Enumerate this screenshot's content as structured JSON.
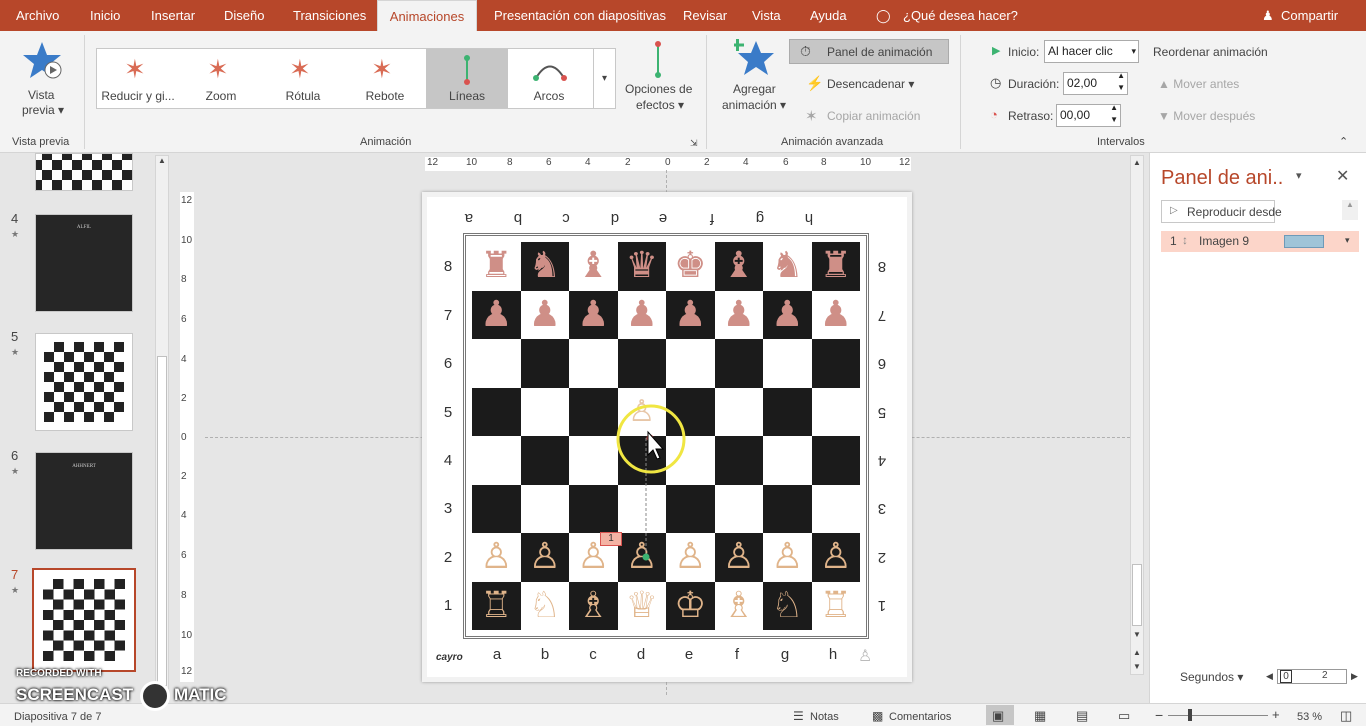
{
  "colors": {
    "accent": "#b7472a",
    "highlight": "#d5d5d5",
    "motion_path": "#3cb371",
    "cursor_highlight": "#f0e642",
    "slide_selected_border": "#b7472a"
  },
  "tabs": [
    {
      "label": "Archivo"
    },
    {
      "label": "Inicio"
    },
    {
      "label": "Insertar"
    },
    {
      "label": "Diseño"
    },
    {
      "label": "Transiciones"
    },
    {
      "label": "Animaciones",
      "active": true
    },
    {
      "label": "Presentación con diapositivas"
    },
    {
      "label": "Revisar"
    },
    {
      "label": "Vista"
    },
    {
      "label": "Ayuda"
    }
  ],
  "tellme": "¿Qué desea hacer?",
  "share": "Compartir",
  "ribbon": {
    "preview_label": "Vista\nprevia",
    "preview_line1": "Vista",
    "preview_line2": "previa",
    "group_preview": "Vista previa",
    "gallery": [
      {
        "label": "Reducir y gi...",
        "icon": "shrink-turn-star-icon"
      },
      {
        "label": "Zoom",
        "icon": "zoom-star-icon"
      },
      {
        "label": "Rótula",
        "icon": "swivel-star-icon"
      },
      {
        "label": "Rebote",
        "icon": "bounce-star-icon"
      },
      {
        "label": "Líneas",
        "icon": "lines-path-icon",
        "selected": true
      },
      {
        "label": "Arcos",
        "icon": "arcs-path-icon"
      }
    ],
    "effect_options_line1": "Opciones de",
    "effect_options_line2": "efectos",
    "group_animation": "Animación",
    "add_animation_line1": "Agregar",
    "add_animation_line2": "animación",
    "animation_pane": "Panel de animación",
    "trigger": "Desencadenar",
    "copy_animation": "Copiar animación",
    "group_advanced": "Animación avanzada",
    "start_label": "Inicio:",
    "start_value": "Al hacer clic",
    "duration_label": "Duración:",
    "duration_value": "02,00",
    "delay_label": "Retraso:",
    "delay_value": "00,00",
    "reorder_title": "Reordenar animación",
    "move_earlier": "Mover antes",
    "move_later": "Mover después",
    "group_timing": "Intervalos"
  },
  "slides": [
    {
      "num": "4",
      "type": "dark",
      "title": "ALFIL"
    },
    {
      "num": "5",
      "type": "chess"
    },
    {
      "num": "6",
      "type": "dark",
      "title": "AHHNERT"
    },
    {
      "num": "7",
      "type": "chess",
      "selected": true
    }
  ],
  "ruler": {
    "h_ticks": [
      "12",
      "10",
      "8",
      "6",
      "4",
      "2",
      "0",
      "2",
      "4",
      "6",
      "8",
      "10",
      "12"
    ],
    "v_ticks": [
      "12",
      "10",
      "8",
      "6",
      "4",
      "2",
      "0",
      "2",
      "4",
      "6",
      "8",
      "10",
      "12"
    ]
  },
  "board": {
    "files_top": [
      "a",
      "b",
      "c",
      "d",
      "e",
      "f",
      "g",
      "h"
    ],
    "files_bottom": [
      "a",
      "b",
      "c",
      "d",
      "e",
      "f",
      "g",
      "h"
    ],
    "ranks_left": [
      "8",
      "7",
      "6",
      "5",
      "4",
      "3",
      "2",
      "1"
    ],
    "ranks_right": [
      "8",
      "7",
      "6",
      "5",
      "4",
      "3",
      "2",
      "1"
    ],
    "brand": "cayro",
    "animation_tag": "1",
    "rows": [
      [
        "♜",
        "♞",
        "♝",
        "♛",
        "♚",
        "♝",
        "♞",
        "♜"
      ],
      [
        "♟",
        "♟",
        "♟",
        "♟",
        "♟",
        "♟",
        "♟",
        "♟"
      ],
      [
        "",
        "",
        "",
        "",
        "",
        "",
        "",
        ""
      ],
      [
        "",
        "",
        "",
        "♙",
        "",
        "",
        "",
        ""
      ],
      [
        "",
        "",
        "",
        "",
        "",
        "",
        "",
        ""
      ],
      [
        "",
        "",
        "",
        "",
        "",
        "",
        "",
        ""
      ],
      [
        "♙",
        "♙",
        "♙",
        "♙",
        "♙",
        "♙",
        "♙",
        "♙"
      ],
      [
        "♖",
        "♘",
        "♗",
        "♕",
        "♔",
        "♗",
        "♘",
        "♖"
      ]
    ]
  },
  "anim_pane": {
    "title": "Panel de ani..",
    "play_from": "Reproducir desde",
    "item_num": "1",
    "item_name": "Imagen 9",
    "footer_unit": "Segundos",
    "zoom_start": "0",
    "zoom_end": "2"
  },
  "status": {
    "slide_info": "Diapositiva 7 de 7",
    "notes": "Notas",
    "comments": "Comentarios",
    "zoom": "53 %"
  },
  "watermark": {
    "line1": "RECORDED WITH",
    "line2": "SCREENCAST",
    "line3": "MATIC"
  }
}
